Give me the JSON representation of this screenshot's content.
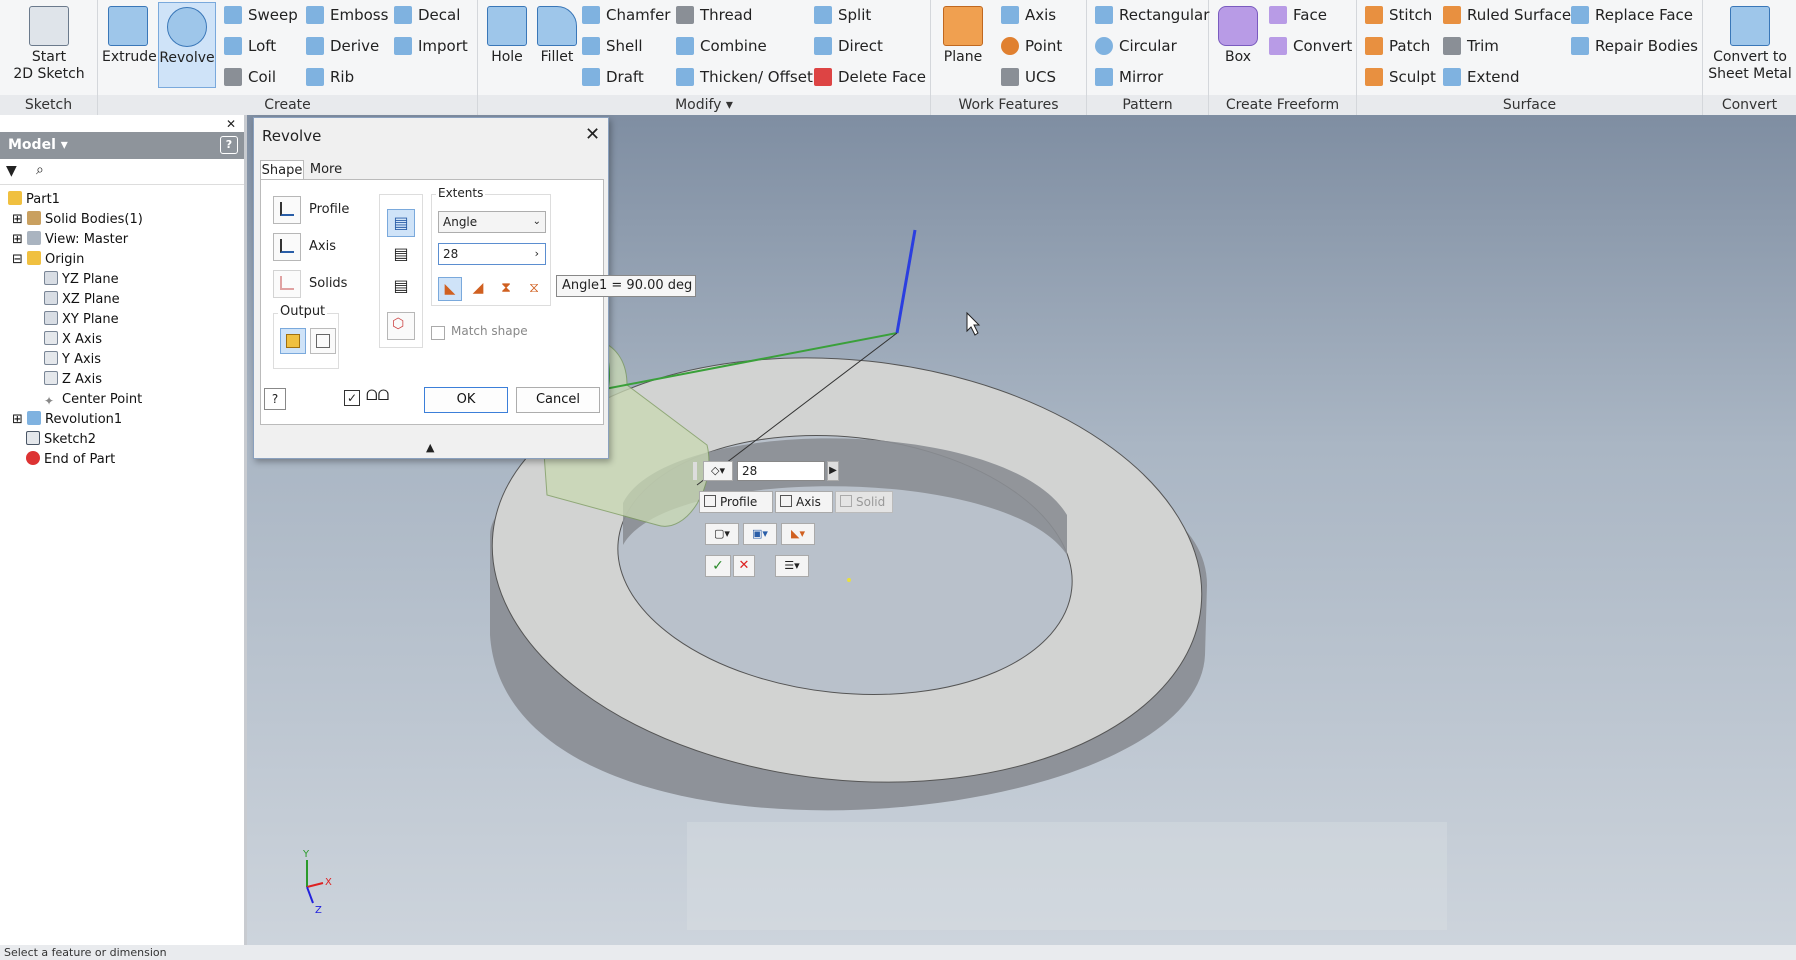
{
  "ribbon": {
    "panels": {
      "sketch": "Sketch",
      "create": "Create",
      "modify": "Modify",
      "work_features": "Work Features",
      "pattern": "Pattern",
      "create_freeform": "Create Freeform",
      "surface": "Surface",
      "convert": "Convert"
    },
    "start_sketch": "Start",
    "start_sketch_2": "2D Sketch",
    "extrude": "Extrude",
    "revolve": "Revolve",
    "sweep": "Sweep",
    "loft": "Loft",
    "coil": "Coil",
    "emboss": "Emboss",
    "derive": "Derive",
    "rib": "Rib",
    "decal": "Decal",
    "import": "Import",
    "hole": "Hole",
    "fillet": "Fillet",
    "chamfer": "Chamfer",
    "shell": "Shell",
    "draft": "Draft",
    "thread": "Thread",
    "combine": "Combine",
    "thicken_offset": "Thicken/ Offset",
    "split": "Split",
    "direct": "Direct",
    "delete_face": "Delete Face",
    "plane": "Plane",
    "axis": "Axis",
    "point": "Point",
    "ucs": "UCS",
    "rectangular": "Rectangular",
    "circular": "Circular",
    "mirror": "Mirror",
    "box": "Box",
    "face": "Face",
    "convert_ff": "Convert",
    "stitch": "Stitch",
    "patch": "Patch",
    "sculpt": "Sculpt",
    "ruled_surface": "Ruled Surface",
    "trim": "Trim",
    "extend": "Extend",
    "replace_face": "Replace Face",
    "repair_bodies": "Repair Bodies",
    "convert_sheet_1": "Convert to",
    "convert_sheet_2": "Sheet Metal"
  },
  "browser": {
    "title": "Model ▾",
    "tree": [
      "Part1",
      "Solid Bodies(1)",
      "View: Master",
      "Origin",
      "YZ Plane",
      "XZ Plane",
      "XY Plane",
      "X Axis",
      "Y Axis",
      "Z Axis",
      "Center Point",
      "Revolution1",
      "Sketch2",
      "End of Part"
    ]
  },
  "dialog": {
    "title": "Revolve",
    "tabs": [
      "Shape",
      "More"
    ],
    "profile": "Profile",
    "axis": "Axis",
    "solids": "Solids",
    "output": "Output",
    "extents": "Extents",
    "extents_value": "Angle",
    "angle_input": "28",
    "tooltip": "Angle1 = 90.00 deg",
    "match_shape": "Match shape",
    "ok": "OK",
    "cancel": "Cancel"
  },
  "minitoolbar": {
    "value": "28",
    "profile": "Profile",
    "axis": "Axis",
    "solid": "Solid"
  },
  "triad": {
    "x": "X",
    "y": "Y",
    "z": "Z"
  },
  "status": "Select a feature or dimension"
}
